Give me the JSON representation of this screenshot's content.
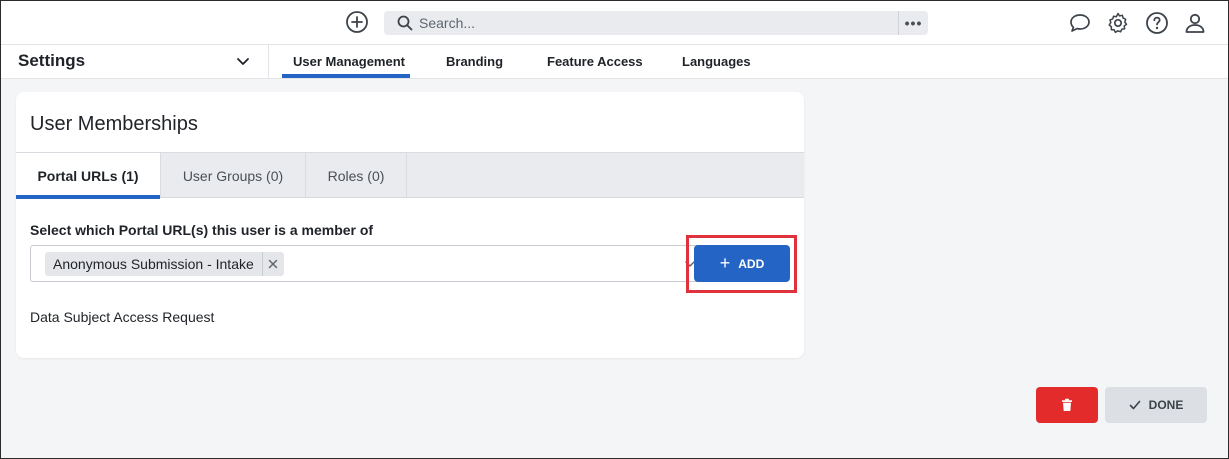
{
  "header": {
    "search_placeholder": "Search...",
    "more_label": "•••",
    "icons": [
      "plus-circle-icon",
      "search-icon",
      "chat-icon",
      "gear-icon",
      "help-icon",
      "user-icon"
    ]
  },
  "settings": {
    "title": "Settings",
    "tabs": [
      {
        "label": "User Management",
        "active": true
      },
      {
        "label": "Branding"
      },
      {
        "label": "Feature Access"
      },
      {
        "label": "Languages"
      }
    ]
  },
  "card": {
    "title": "User Memberships",
    "tabs": [
      {
        "label": "Portal URLs (1)",
        "active": true
      },
      {
        "label": "User Groups (0)"
      },
      {
        "label": "Roles (0)"
      }
    ],
    "field_label": "Select which Portal URL(s) this user is a member of",
    "selected_chip": "Anonymous Submission - Intake",
    "add_label": "ADD",
    "portal_item": "Data Subject Access Request"
  },
  "footer": {
    "done_label": "DONE"
  },
  "colors": {
    "accent": "#2364c4",
    "danger": "#e32b2b",
    "highlight": "#e0323c"
  }
}
